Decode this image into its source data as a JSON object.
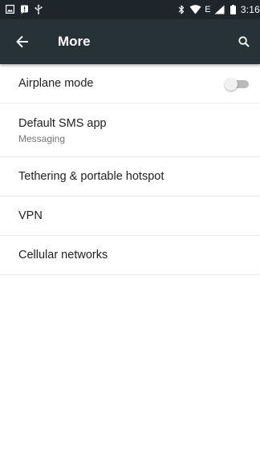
{
  "status_bar": {
    "time": "3:16",
    "left_icons": [
      "image-notification-icon",
      "alert-notification-icon",
      "usb-icon"
    ],
    "right_icons": [
      "bluetooth-icon",
      "wifi-icon",
      "data-e-icon",
      "cell-signal-icon",
      "battery-icon"
    ],
    "network_label": "E",
    "background": "#1e262c"
  },
  "toolbar": {
    "title": "More",
    "back_icon": "arrow-back-icon",
    "search_icon": "search-icon",
    "background": "#263238"
  },
  "settings": {
    "items": [
      {
        "title": "Airplane mode",
        "toggle": "off"
      },
      {
        "title": "Default SMS app",
        "summary": "Messaging"
      },
      {
        "title": "Tethering & portable hotspot"
      },
      {
        "title": "VPN"
      },
      {
        "title": "Cellular networks"
      }
    ]
  }
}
